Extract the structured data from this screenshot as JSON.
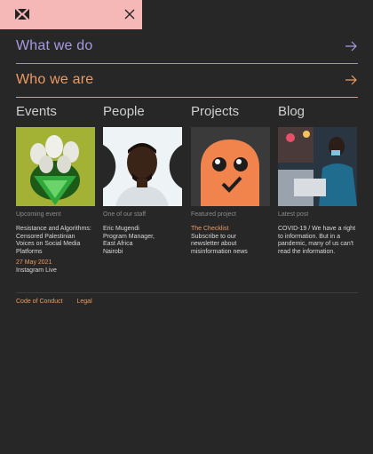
{
  "nav": {
    "what_we_do": "What we do",
    "who_we_are": "Who we are"
  },
  "columns": {
    "events": {
      "heading": "Events",
      "kind": "Upcoming event",
      "title_lines": [
        "Resistance and Algorithms:",
        "Censored Palestinian",
        "Voices on Social Media",
        "Platforms"
      ],
      "date": "27 May 2021",
      "venue": "Instagram Live"
    },
    "people": {
      "heading": "People",
      "kind": "One of our staff",
      "lines": [
        "Eric Mugendi",
        "Program Manager,",
        "East Africa",
        "Nairobi"
      ]
    },
    "projects": {
      "heading": "Projects",
      "kind": "Featured project",
      "name": "The Checklist",
      "lines": [
        "Subscribe to our",
        "newsletter about",
        "misinformation news"
      ]
    },
    "blog": {
      "heading": "Blog",
      "kind": "Latest post",
      "lines": [
        "COVID-19 / We have a right",
        "to information. But in a",
        "pandemic, many of us can't",
        "read the information."
      ]
    }
  },
  "footer": {
    "code_of_conduct": "Code of Conduct",
    "legal": "Legal"
  },
  "colors": {
    "background": "#272727",
    "topbar": "#f6b7b7",
    "purple": "#a89ae0",
    "orange": "#ed9a63"
  },
  "icons": [
    "logo-icon",
    "close-icon",
    "arrow-right-icon"
  ]
}
